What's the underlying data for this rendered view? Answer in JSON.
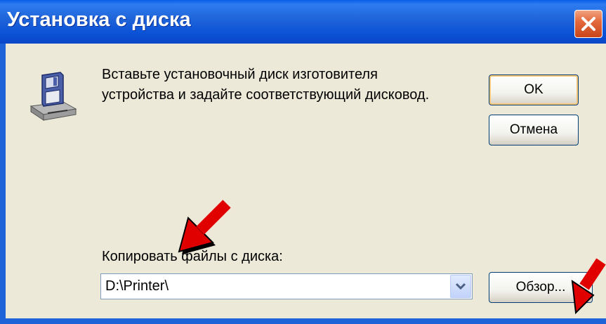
{
  "window": {
    "title": "Установка с диска",
    "close_icon": "close-icon"
  },
  "dialog": {
    "message_line1": "Вставьте установочный диск изготовителя",
    "message_line2": "устройства и задайте соответствующий дисковод.",
    "icon": "floppy-disk-drive-icon",
    "ok_label": "OK",
    "cancel_label": "Отмена",
    "copy_label": "Копировать файлы с диска:",
    "path_value": "D:\\Printer\\",
    "browse_label": "Обзор..."
  },
  "annotations": {
    "arrow_color": "#e00000",
    "arrow_icon": "red-arrow-icon"
  },
  "colors": {
    "titlebar": "#0b53d8",
    "dialog_bg": "#ece9d8",
    "close_button": "#e46a3e"
  }
}
